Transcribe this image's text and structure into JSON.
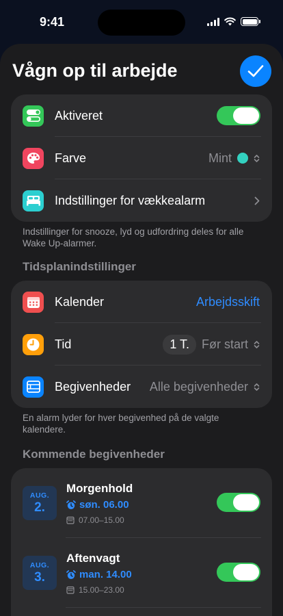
{
  "status_bar": {
    "time": "9:41"
  },
  "sheet": {
    "title": "Vågn op til arbejde"
  },
  "settings": {
    "activated_label": "Aktiveret",
    "activated_on": true,
    "color_label": "Farve",
    "color_value": "Mint",
    "color_hex": "#33d1c0",
    "alarm_settings_label": "Indstillinger for vækkealarm"
  },
  "settings_footnote": "Indstillinger for snooze, lyd og udfordring deles for alle Wake Up-alarmer.",
  "schedule": {
    "header": "Tidsplanindstillinger",
    "calendar_label": "Kalender",
    "calendar_value": "Arbejdsskift",
    "time_label": "Tid",
    "time_offset": "1 T.",
    "time_value": "Før start",
    "events_label": "Begivenheder",
    "events_value": "Alle begivenheder"
  },
  "schedule_footnote": "En alarm lyder for hver begivenhed på de valgte kalendere.",
  "upcoming": {
    "header": "Kommende begivenheder",
    "events": [
      {
        "month": "AUG.",
        "day": "2.",
        "title": "Morgenhold",
        "alarm": "søn. 06.00",
        "time": "07.00–15.00",
        "enabled": true
      },
      {
        "month": "AUG.",
        "day": "3.",
        "title": "Aftenvagt",
        "alarm": "man. 14.00",
        "time": "15.00–23.00",
        "enabled": true
      }
    ]
  },
  "colors": {
    "accent": "#0a84ff",
    "toggle_on": "#34c759",
    "icon_green": "#34c759",
    "icon_pink": "#f0455f",
    "icon_teal": "#2ccfd0",
    "icon_red": "#ef4f4f",
    "icon_orange": "#ff9f0a",
    "icon_blue": "#0a84ff"
  }
}
